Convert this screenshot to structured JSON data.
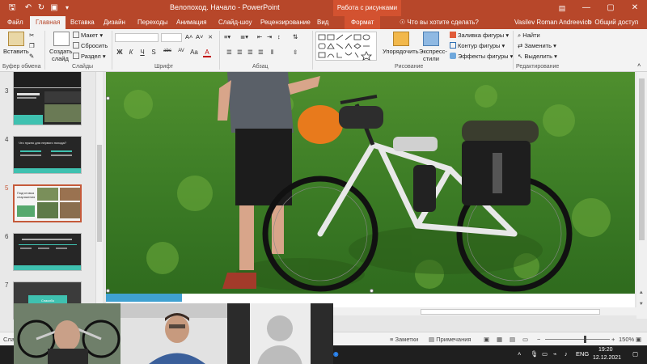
{
  "titlebar": {
    "doc_title": "Велопоход. Начало - PowerPoint",
    "context_title": "Работа с рисунками",
    "controls": [
      "—",
      "▢",
      "✕"
    ]
  },
  "tabs": {
    "file": "Файл",
    "home": "Главная",
    "insert": "Вставка",
    "design": "Дизайн",
    "transitions": "Переходы",
    "animation": "Анимация",
    "slideshow": "Слайд-шоу",
    "review": "Рецензирование",
    "view": "Вид",
    "format": "Формат",
    "tellme": "Что вы хотите сделать?",
    "user": "Vasilev Roman Andreevich",
    "share": "Общий доступ"
  },
  "ribbon": {
    "clipboard": {
      "paste": "Вставить",
      "label": "Буфер обмена"
    },
    "slides": {
      "new_slide_1": "Создать",
      "new_slide_2": "слайд",
      "layout": "Макет",
      "reset": "Сбросить",
      "section": "Раздел",
      "label": "Слайды"
    },
    "font": {
      "label": "Шрифт",
      "buttons": [
        "Ж",
        "К",
        "Ч",
        "S",
        "abc",
        "AV",
        "Aa",
        "A"
      ]
    },
    "paragraph": {
      "label": "Абзац"
    },
    "drawing": {
      "arrange_1": "Упорядочить",
      "quick_1": "Экспресс-",
      "quick_2": "стили",
      "fill": "Заливка фигуры",
      "outline": "Контур фигуры",
      "effects": "Эффекты фигуры",
      "label": "Рисование"
    },
    "editing": {
      "find": "Найти",
      "replace": "Заменить",
      "select": "Выделить",
      "label": "Редактирование"
    }
  },
  "slides_panel": {
    "numbers": [
      "3",
      "4",
      "5",
      "6",
      "7"
    ],
    "slide4_title": "Что нужно для первого похода?",
    "slide5_title": "Подготовка снаряжения",
    "slide7_title": "Спасибо"
  },
  "statusbar": {
    "left": "Слай",
    "notes": "Заметки",
    "comments": "Примечания",
    "zoom": "150%"
  },
  "taskbar": {
    "lang": "ENG",
    "time": "19:20",
    "date": "12.12.2021"
  },
  "colors": {
    "accent": "#b7472a",
    "context": "#d35230",
    "teal": "#3fc1b0"
  }
}
